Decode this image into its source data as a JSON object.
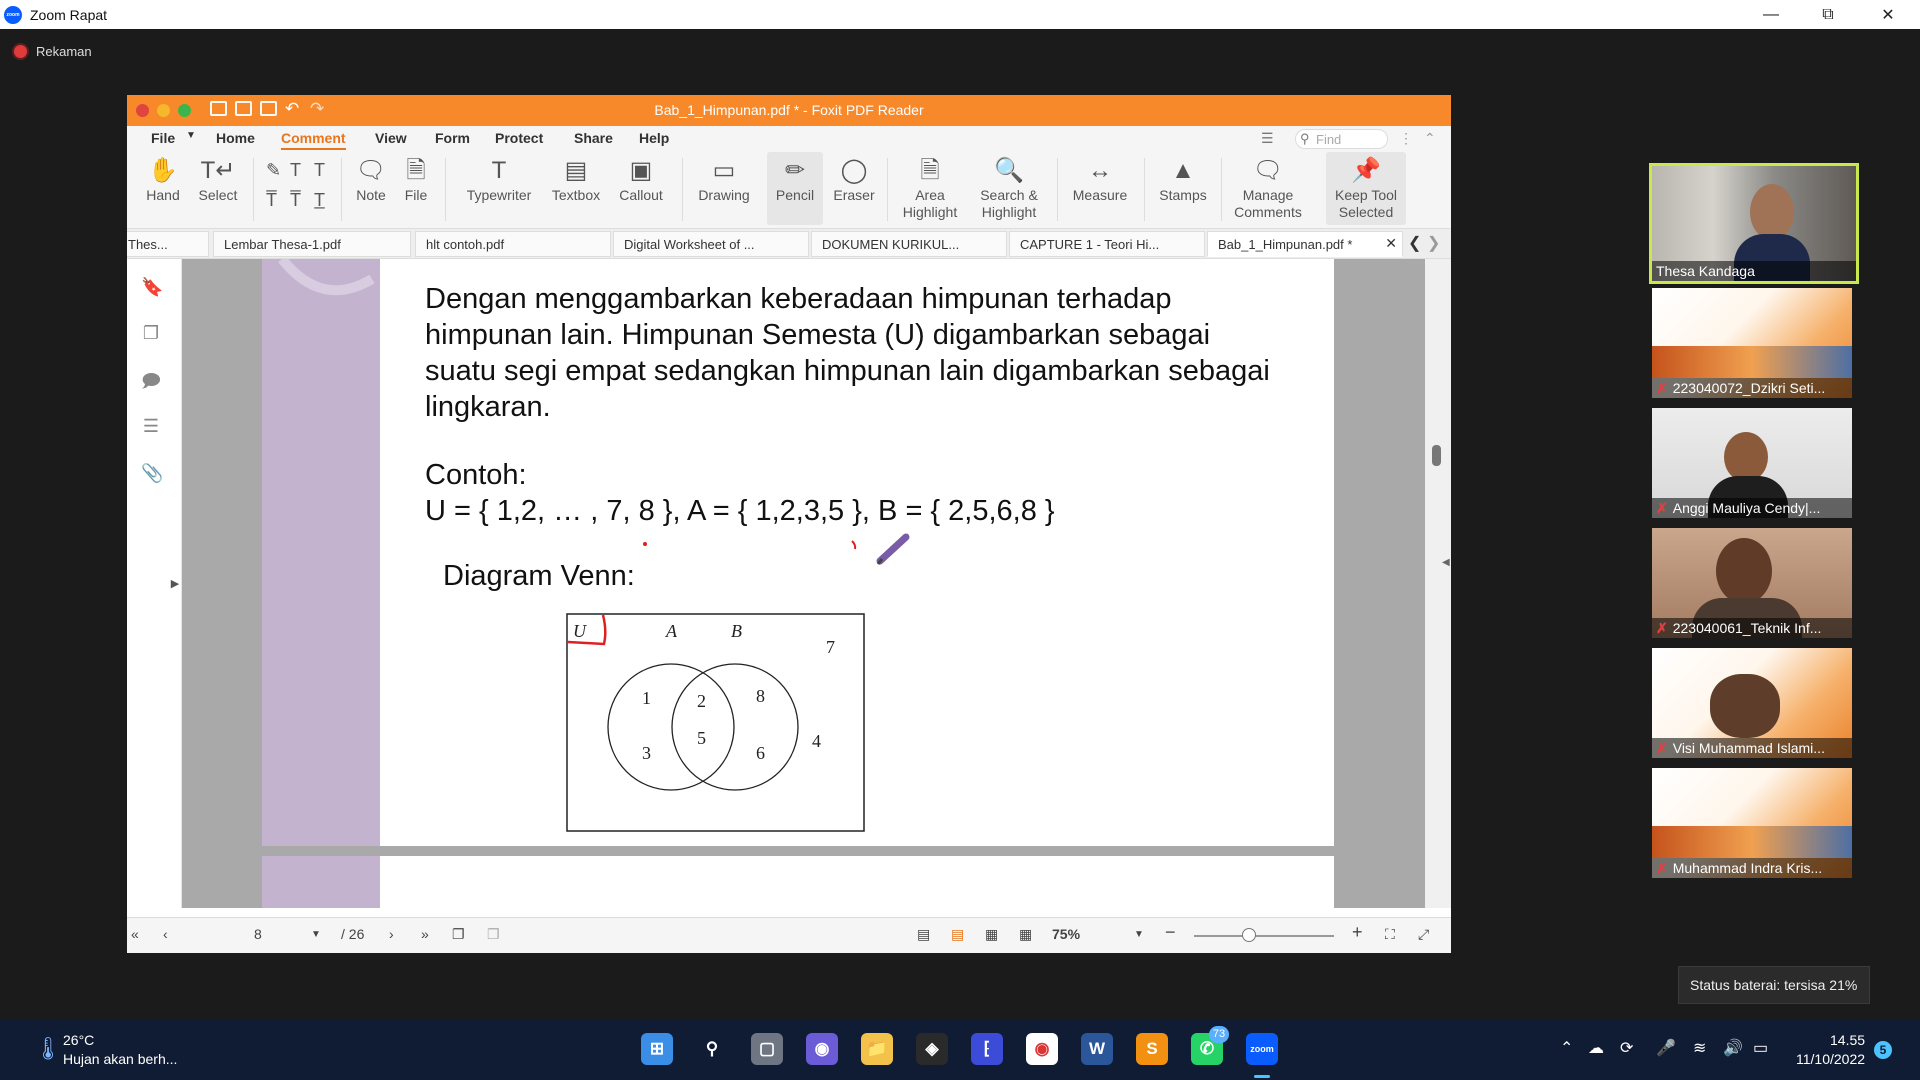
{
  "zoom": {
    "window_title": "Zoom Rapat",
    "recording_label": "Rekaman",
    "battery_toast": "Status baterai: tersisa 21%"
  },
  "foxit": {
    "title": "Bab_1_Himpunan.pdf * - Foxit PDF Reader",
    "menu": [
      "File",
      "Home",
      "Comment",
      "View",
      "Form",
      "Protect",
      "Share",
      "Help"
    ],
    "find_placeholder": "Find",
    "tools": {
      "hand": "Hand",
      "select": "Select",
      "note": "Note",
      "file": "File",
      "typewriter": "Typewriter",
      "textbox": "Textbox",
      "callout": "Callout",
      "drawing": "Drawing",
      "pencil": "Pencil",
      "eraser": "Eraser",
      "area_highlight_1": "Area",
      "area_highlight_2": "Highlight",
      "search_highlight_1": "Search &",
      "search_highlight_2": "Highlight",
      "measure": "Measure",
      "stamps": "Stamps",
      "manage_comments_1": "Manage",
      "manage_comments_2": "Comments",
      "keep_tool_1": "Keep Tool",
      "keep_tool_2": "Selected"
    },
    "tabs": [
      "Thes...",
      "Lembar Thesa-1.pdf",
      "hlt contoh.pdf",
      "Digital Worksheet of ...",
      "DOKUMEN KURIKUL...",
      "CAPTURE 1 - Teori Hi...",
      "Bab_1_Himpunan.pdf *"
    ],
    "document": {
      "paragraph": "Dengan menggambarkan keberadaan himpunan terhadap himpunan lain. Himpunan Semesta (U) digambarkan sebagai suatu segi empat sedangkan himpunan lain digambarkan sebagai lingkaran.",
      "example_label": "Contoh:",
      "example_line": "U = { 1,2, … , 7, 8 }, A = { 1,2,3,5 }, B = { 2,5,6,8 }",
      "venn_title": "Diagram Venn:",
      "venn": {
        "universe_label": "U",
        "set_a_label": "A",
        "set_b_label": "B",
        "only_a": [
          "1",
          "3"
        ],
        "intersection": [
          "2",
          "5"
        ],
        "only_b": [
          "8",
          "6"
        ],
        "outside": [
          "7",
          "4"
        ]
      }
    },
    "status": {
      "current_page": "8",
      "total_pages": "/ 26",
      "zoom": "75%"
    },
    "colors": {
      "titlebar": "#f7892a",
      "accent": "#e8761e",
      "annotation_red": "#e02020"
    }
  },
  "participants": [
    {
      "name": "Thesa Kandaga",
      "muted": false,
      "speaking": true
    },
    {
      "name": "223040072_Dzikri Seti...",
      "muted": true
    },
    {
      "name": "Anggi Mauliya Cendy|...",
      "muted": true
    },
    {
      "name": "223040061_Teknik Inf...",
      "muted": true
    },
    {
      "name": "Visi Muhammad Islami...",
      "muted": true
    },
    {
      "name": "Muhammad Indra Kris...",
      "muted": true
    }
  ],
  "taskbar": {
    "weather_temp": "26°C",
    "weather_desc": "Hujan akan berh...",
    "time": "14.55",
    "date": "11/10/2022",
    "whatsapp_badge": "73",
    "notification_count": "5"
  }
}
